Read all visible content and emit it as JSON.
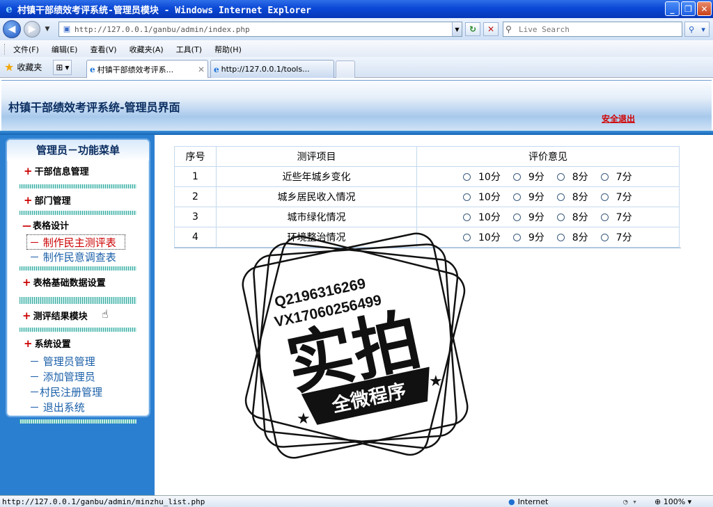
{
  "window": {
    "title": "村镇干部绩效考评系统-管理员模块 - Windows Internet Explorer",
    "controls": [
      "_",
      "❐",
      "✕"
    ]
  },
  "address_bar": {
    "url": "http://127.0.0.1/ganbu/admin/index.php"
  },
  "search_box": {
    "placeholder": "Live Search"
  },
  "menu_bar": {
    "items": [
      "文件(F)",
      "编辑(E)",
      "查看(V)",
      "收藏夹(A)",
      "工具(T)",
      "帮助(H)"
    ]
  },
  "tabs": {
    "favorites_label": "收藏夹",
    "items": [
      {
        "label": "村镇干部绩效考评系...",
        "active": true
      },
      {
        "label": "http://127.0.0.1/tools...",
        "active": false
      }
    ]
  },
  "page": {
    "banner_title": "村镇干部绩效考评系统-管理员界面",
    "logout_label": "安全退出"
  },
  "sidebar": {
    "header": "管理员－功能菜单",
    "sections": [
      {
        "label": "干部信息管理",
        "marker": "+",
        "items": []
      },
      {
        "label": "部门管理",
        "marker": "+",
        "items": []
      },
      {
        "label": "表格设计",
        "marker": "—",
        "items": [
          "－ 制作民主测评表",
          "－ 制作民意调查表"
        ],
        "active_item": 0
      },
      {
        "label": "表格基础数据设置",
        "marker": "+",
        "items": []
      },
      {
        "label": "测评结果模块",
        "marker": "+",
        "items": []
      },
      {
        "label": "系统设置",
        "marker": "+",
        "items": [
          "－ 管理员管理",
          "－ 添加管理员",
          "－村民注册管理",
          "－ 退出系统"
        ]
      }
    ]
  },
  "eval_table": {
    "headers": [
      "序号",
      "测评项目",
      "评价意见"
    ],
    "options": [
      "10分",
      "9分",
      "8分",
      "7分"
    ],
    "rows": [
      {
        "no": "1",
        "item": "近些年城乡变化"
      },
      {
        "no": "2",
        "item": "城乡居民收入情况"
      },
      {
        "no": "3",
        "item": "城市绿化情况"
      },
      {
        "no": "4",
        "item": "环境整治情况"
      }
    ]
  },
  "watermark": {
    "qq": "Q2196316269",
    "vx": "VX17060256499",
    "big_text": "实拍",
    "ribbon_text": "全微程序"
  },
  "status_bar": {
    "status_text": "http://127.0.0.1/ganbu/admin/minzhu_list.php",
    "zone": "Internet",
    "zoom": "100%"
  }
}
